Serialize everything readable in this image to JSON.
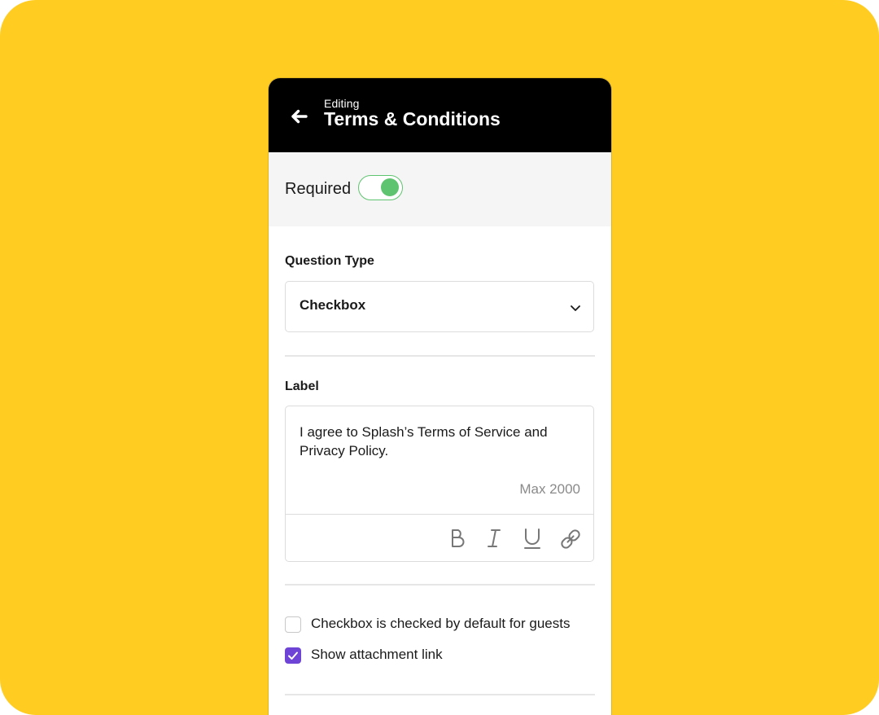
{
  "colors": {
    "background": "#FFCC22",
    "header_bg": "#000000",
    "toggle_accent": "#5FC46F",
    "checkbox_accent": "#6E44D6",
    "muted_text": "#8A8A8A"
  },
  "header": {
    "back_icon": "arrow-left-icon",
    "subtitle": "Editing",
    "title": "Terms & Conditions"
  },
  "required": {
    "label": "Required",
    "enabled": true
  },
  "question_type": {
    "label": "Question Type",
    "selected": "Checkbox",
    "icon": "chevron-down-icon"
  },
  "label_field": {
    "label": "Label",
    "value": "I agree to Splash’s Terms of Service and Privacy Policy.",
    "limit_text": "Max 2000",
    "toolbar": [
      "bold-icon",
      "italic-icon",
      "underline-icon",
      "link-icon"
    ]
  },
  "options": [
    {
      "label": "Checkbox is checked by default for guests",
      "checked": false
    },
    {
      "label": "Show attachment link",
      "checked": true
    }
  ]
}
